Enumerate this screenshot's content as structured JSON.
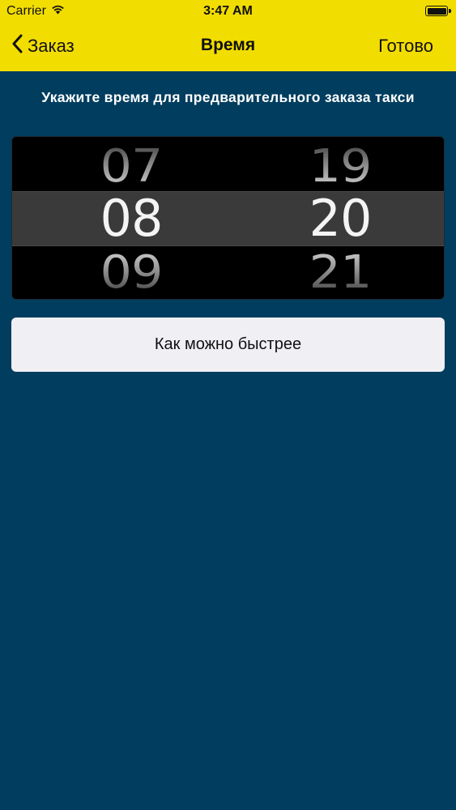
{
  "status_bar": {
    "carrier": "Carrier",
    "time": "3:47 AM",
    "wifi_icon": "wifi-icon",
    "battery_icon": "battery-icon"
  },
  "nav": {
    "back_label": "Заказ",
    "title": "Время",
    "done_label": "Готово"
  },
  "prompt": "Укажите время для предварительного заказа такси",
  "picker": {
    "hours": {
      "above": "07",
      "selected": "08",
      "below": "09"
    },
    "minutes": {
      "above": "19",
      "selected": "20",
      "below": "21"
    }
  },
  "asap_button": "Как можно быстрее",
  "colors": {
    "header": "#f2dd00",
    "background": "#003d5e",
    "picker_bg": "#000000",
    "picker_selection": "#3a3a3a",
    "button_bg": "#efeff4"
  }
}
